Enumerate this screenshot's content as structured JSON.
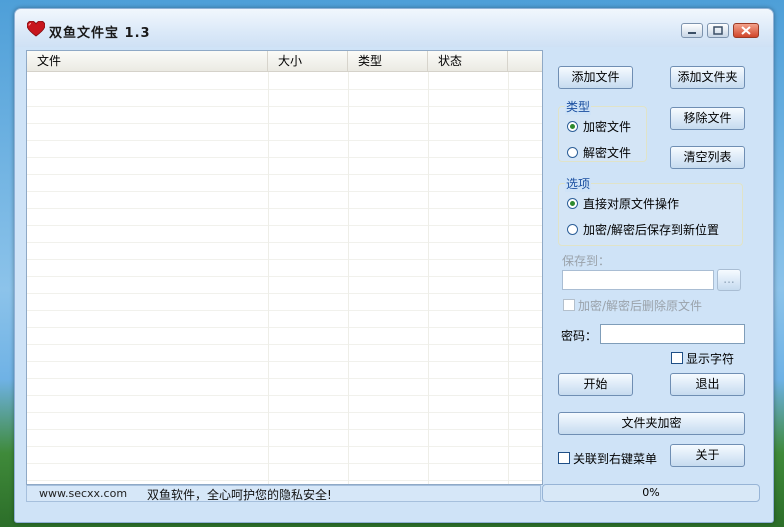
{
  "window": {
    "title": "双鱼文件宝  1.3"
  },
  "file_list": {
    "columns": [
      "文件",
      "大小",
      "类型",
      "状态"
    ],
    "rows": []
  },
  "buttons": {
    "add_file": "添加文件",
    "add_folder": "添加文件夹",
    "remove_file": "移除文件",
    "clear_list": "清空列表",
    "start": "开始",
    "exit": "退出",
    "folder_encrypt": "文件夹加密",
    "about": "关于",
    "browse": "..."
  },
  "type_group": {
    "title": "类型",
    "options": [
      "加密文件",
      "解密文件"
    ],
    "selected": "加密文件"
  },
  "options_group": {
    "title": "选项",
    "options": [
      "直接对原文件操作",
      "加密/解密后保存到新位置"
    ],
    "selected": "直接对原文件操作"
  },
  "save_to": {
    "label": "保存到：",
    "value": ""
  },
  "delete_original": {
    "label": "加密/解密后删除原文件",
    "checked": false,
    "enabled": false
  },
  "password": {
    "label": "密码：",
    "value": ""
  },
  "show_chars": {
    "label": "显示字符",
    "checked": false
  },
  "context_menu": {
    "label": "关联到右键菜单",
    "checked": false
  },
  "status": {
    "url": "www.secxx.com",
    "slogan": "双鱼软件，全心呵护您的隐私安全!",
    "progress_text": "0%",
    "progress": 0
  },
  "icons": {
    "app": "heart-icon",
    "minimize": "minimize-icon",
    "maximize": "maximize-icon",
    "close": "close-icon"
  }
}
